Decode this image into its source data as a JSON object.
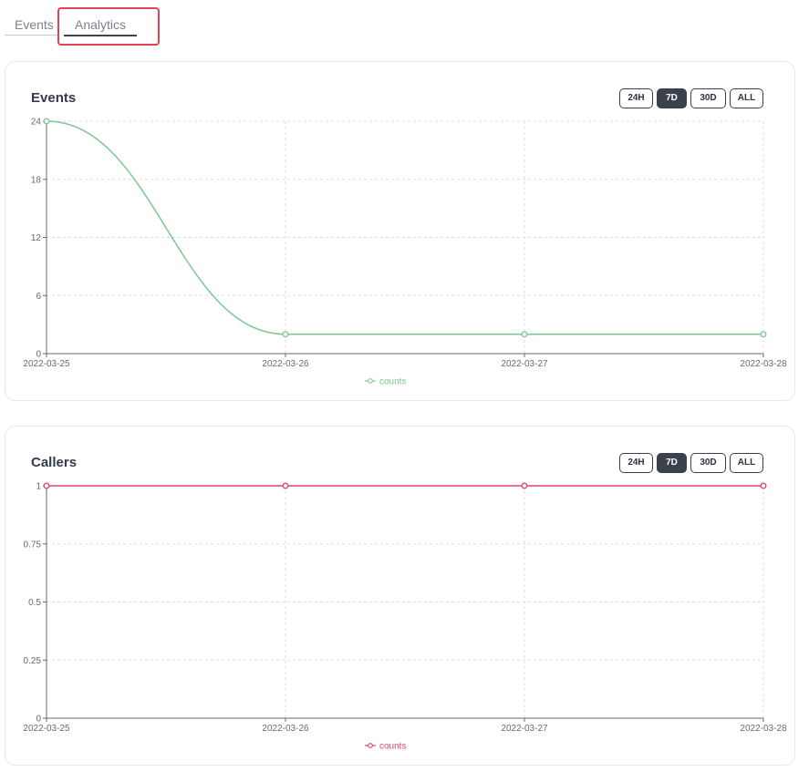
{
  "tabs": [
    {
      "label": "Events",
      "active": false
    },
    {
      "label": "Analytics",
      "active": true
    }
  ],
  "range_buttons": [
    "24H",
    "7D",
    "30D",
    "ALL"
  ],
  "active_range": "7D",
  "colors": {
    "events_series": "#7ec793",
    "callers_series": "#e0456b",
    "active_button": "#3b414d",
    "highlight_box": "#e1454f"
  },
  "charts": {
    "events": {
      "title": "Events",
      "legend": "counts",
      "chart_data": {
        "type": "line",
        "x": [
          "2022-03-25",
          "2022-03-26",
          "2022-03-27",
          "2022-03-28"
        ],
        "series": [
          {
            "name": "counts",
            "values": [
              24,
              2,
              2,
              2
            ]
          }
        ],
        "ylim": [
          0,
          24
        ],
        "yticks": [
          "0",
          "6",
          "12",
          "18",
          "24"
        ],
        "grid": true,
        "legend_position": "bottom"
      }
    },
    "callers": {
      "title": "Callers",
      "legend": "counts",
      "chart_data": {
        "type": "line",
        "x": [
          "2022-03-25",
          "2022-03-26",
          "2022-03-27",
          "2022-03-28"
        ],
        "series": [
          {
            "name": "counts",
            "values": [
              1,
              1,
              1,
              1
            ]
          }
        ],
        "ylim": [
          0,
          1
        ],
        "yticks": [
          "0",
          "0.25",
          "0.5",
          "0.75",
          "1"
        ],
        "grid": true,
        "legend_position": "bottom"
      }
    }
  }
}
